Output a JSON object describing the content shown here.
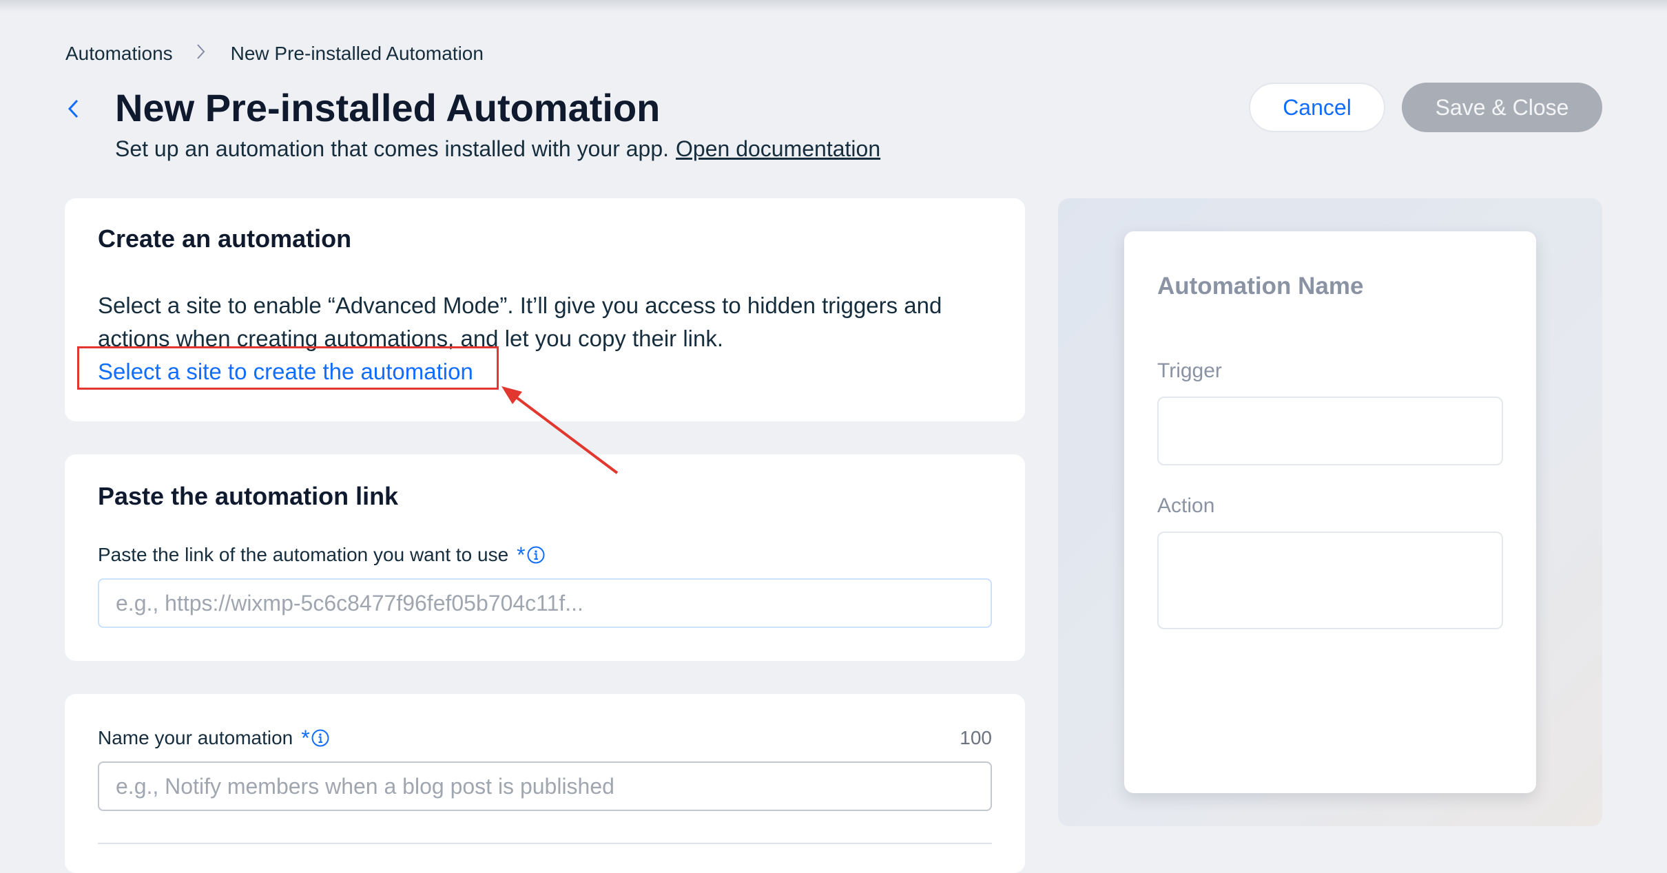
{
  "breadcrumb": {
    "root": "Automations",
    "separator": "›",
    "current": "New Pre-installed Automation"
  },
  "header": {
    "title": "New Pre-installed Automation",
    "subtitle": "Set up an automation that comes installed with your app.",
    "doc_link": "Open documentation",
    "cancel_label": "Cancel",
    "save_label": "Save & Close"
  },
  "create_card": {
    "title": "Create an automation",
    "description": "Select a site to enable “Advanced Mode”. It’ll give you access to hidden triggers and actions when creating automations, and let you copy their link.",
    "link": "Select a site to create the automation"
  },
  "paste_card": {
    "title": "Paste the automation link",
    "label": "Paste the link of the automation you want to use",
    "required": "*",
    "placeholder": "e.g., https://wixmp-5c6c8477f96fef05b704c11f..."
  },
  "name_card": {
    "label": "Name your automation",
    "required": "*",
    "char_limit": "100",
    "placeholder": "e.g., Notify members when a blog post is published"
  },
  "preview": {
    "name": "Automation Name",
    "trigger_label": "Trigger",
    "action_label": "Action"
  },
  "colors": {
    "accent": "#116dff",
    "annotation": "#e2372e",
    "disabled_button": "#a9adb6"
  },
  "icons": {
    "back": "chevron-left-icon",
    "separator": "chevron-right-icon",
    "info": "info-icon"
  }
}
